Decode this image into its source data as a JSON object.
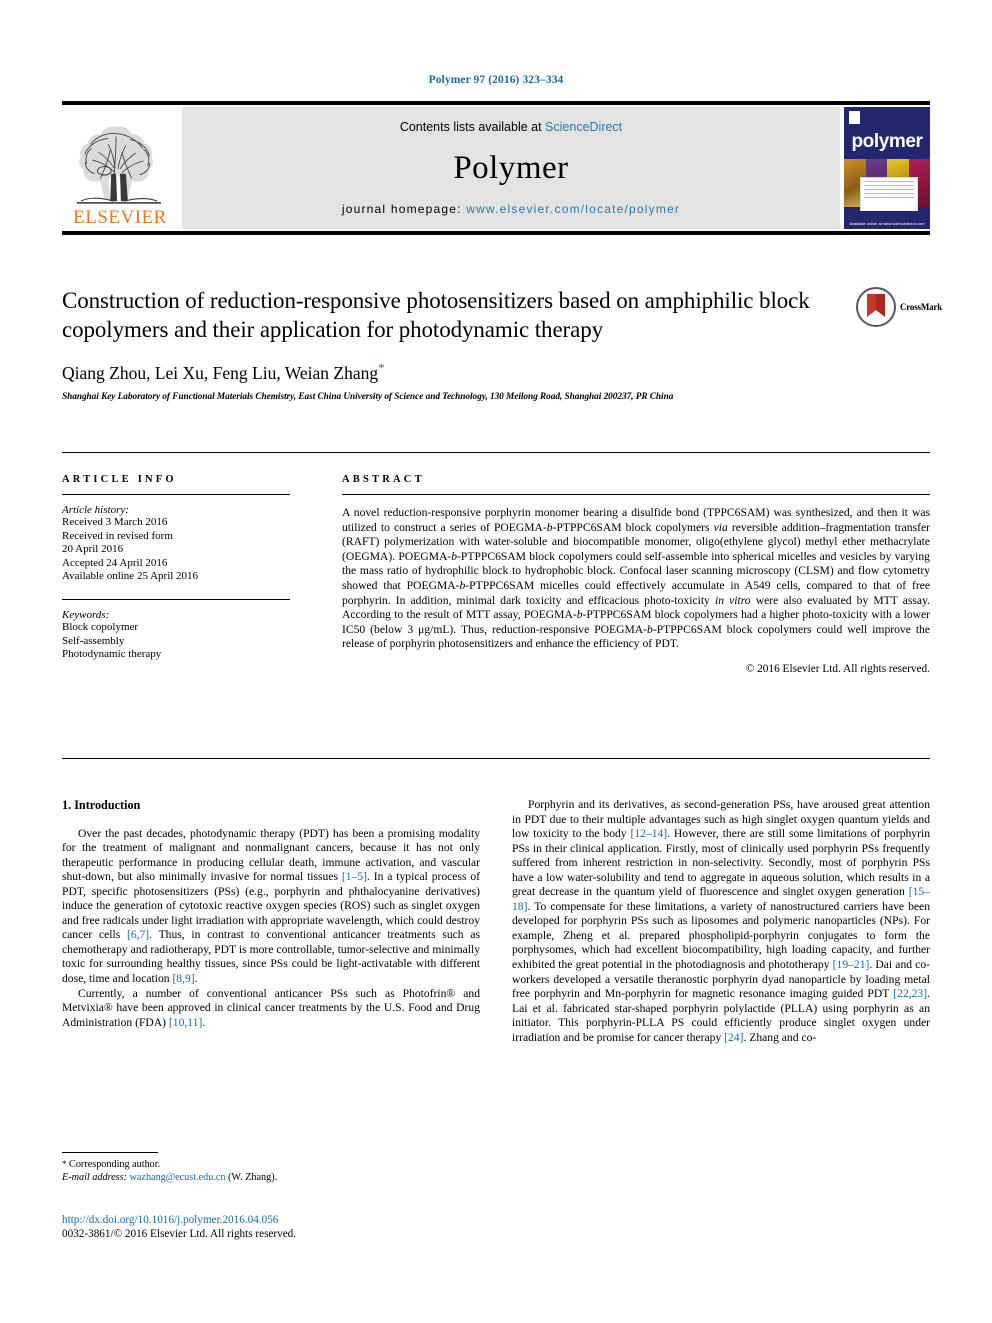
{
  "running_head": "Polymer 97 (2016) 323–334",
  "masthead": {
    "publisher_name": "ELSEVIER",
    "contents_prefix": "Contents lists available at ",
    "contents_link": "ScienceDirect",
    "journal_name": "Polymer",
    "homepage_prefix": "journal homepage: ",
    "homepage_url": "www.elsevier.com/locate/polymer",
    "cover_word": "polymer",
    "cover_footer": "Available online at www.sciencedirect.com"
  },
  "title_block": {
    "title": "Construction of reduction-responsive photosensitizers based on amphiphilic block copolymers and their application for photodynamic therapy",
    "authors": "Qiang Zhou, Lei Xu, Feng Liu, Weian Zhang",
    "corresponding_marker": "*",
    "affiliation": "Shanghai Key Laboratory of Functional Materials Chemistry, East China University of Science and Technology, 130 Meilong Road, Shanghai 200237, PR China",
    "crossmark_label": "CrossMark"
  },
  "article_info": {
    "heading": "ARTICLE INFO",
    "history_label": "Article history:",
    "history_lines": [
      "Received 3 March 2016",
      "Received in revised form",
      "20 April 2016",
      "Accepted 24 April 2016",
      "Available online 25 April 2016"
    ],
    "keywords_label": "Keywords:",
    "keywords": [
      "Block copolymer",
      "Self-assembly",
      "Photodynamic therapy"
    ]
  },
  "abstract": {
    "heading": "ABSTRACT",
    "text": "A novel reduction-responsive porphyrin monomer bearing a disulfide bond (TPPC6SAM) was synthesized, and then it was utilized to construct a series of POEGMA-b-PTPPC6SAM block copolymers via reversible addition–fragmentation transfer (RAFT) polymerization with water-soluble and biocompatible monomer, oligo(ethylene glycol) methyl ether methacrylate (OEGMA). POEGMA-b-PTPPC6SAM block copolymers could self-assemble into spherical micelles and vesicles by varying the mass ratio of hydrophilic block to hydrophobic block. Confocal laser scanning microscopy (CLSM) and flow cytometry showed that POEGMA-b-PTPPC6SAM micelles could effectively accumulate in A549 cells, compared to that of free porphyrin. In addition, minimal dark toxicity and efficacious photo-toxicity in vitro were also evaluated by MTT assay. According to the result of MTT assay, POEGMA-b-PTPPC6SAM block copolymers had a higher photo-toxicity with a lower IC50 (below 3 μg/mL). Thus, reduction-responsive POEGMA-b-PTPPC6SAM block copolymers could well improve the release of porphyrin photosensitizers and enhance the efficiency of PDT.",
    "copyright": "© 2016 Elsevier Ltd. All rights reserved."
  },
  "body": {
    "section_heading": "1. Introduction",
    "left_paragraph_1": "Over the past decades, photodynamic therapy (PDT) has been a promising modality for the treatment of malignant and nonmalignant cancers, because it has not only therapeutic performance in producing cellular death, immune activation, and vascular shut-down, but also minimally invasive for normal tissues [1–5]. In a typical process of PDT, specific photosensitizers (PSs) (e.g., porphyrin and phthalocyanine derivatives) induce the generation of cytotoxic reactive oxygen species (ROS) such as singlet oxygen and free radicals under light irradiation with appropriate wavelength, which could destroy cancer cells [6,7]. Thus, in contrast to conventional anticancer treatments such as chemotherapy and radiotherapy, PDT is more controllable, tumor-selective and minimally toxic for surrounding healthy tissues, since PSs could be light-activatable with different dose, time and location [8,9].",
    "left_paragraph_2": "Currently, a number of conventional anticancer PSs such as Photofrin® and Metvixia® have been approved in clinical cancer treatments by the U.S. Food and Drug Administration (FDA) [10,11].",
    "right_paragraph_1": "Porphyrin and its derivatives, as second-generation PSs, have aroused great attention in PDT due to their multiple advantages such as high singlet oxygen quantum yields and low toxicity to the body [12–14]. However, there are still some limitations of porphyrin PSs in their clinical application. Firstly, most of clinically used porphyrin PSs frequently suffered from inherent restriction in non-selectivity. Secondly, most of porphyrin PSs have a low water-solubility and tend to aggregate in aqueous solution, which results in a great decrease in the quantum yield of fluorescence and singlet oxygen generation [15–18]. To compensate for these limitations, a variety of nanostructured carriers have been developed for porphyrin PSs such as liposomes and polymeric nanoparticles (NPs). For example, Zheng et al. prepared phospholipid-porphyrin conjugates to form the porphysomes, which had excellent biocompatibility, high loading capacity, and further exhibited the great potential in the photodiagnosis and phototherapy [19–21]. Dai and co-workers developed a versatile theranostic porphyrin dyad nanoparticle by loading metal free porphyrin and Mn-porphyrin for magnetic resonance imaging guided PDT [22,23]. Lai et al. fabricated star-shaped porphyrin polylactide (PLLA) using porphyrin as an initiator. This porphyrin-PLLA PS could efficiently produce singlet oxygen under irradiation and be promise for cancer therapy [24]. Zhang and co-"
  },
  "footnote": {
    "corresponding_star": "*",
    "corresponding_text": "Corresponding author.",
    "email_label": "E-mail address:",
    "email": "wazhang@ecust.edu.cn",
    "email_suffix": "(W. Zhang)."
  },
  "imprint": {
    "doi": "http://dx.doi.org/10.1016/j.polymer.2016.04.056",
    "issn": "0032-3861/© 2016 Elsevier Ltd. All rights reserved."
  },
  "colors": {
    "link_blue": "#1a6ba0",
    "elsevier_orange": "#e87722",
    "cover_navy": "#23276e",
    "band_gray": "#e3e3e3"
  }
}
